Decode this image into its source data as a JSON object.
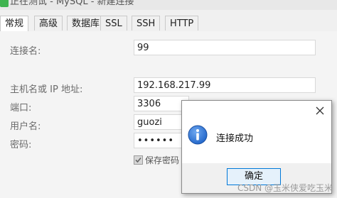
{
  "window": {
    "title": "正在测试 - MySQL - 新建连接"
  },
  "tabs": [
    {
      "label": "常规",
      "active": true
    },
    {
      "label": "高级",
      "active": false
    },
    {
      "label": "数据库",
      "active": false
    },
    {
      "label": "SSL",
      "active": false
    },
    {
      "label": "SSH",
      "active": false
    },
    {
      "label": "HTTP",
      "active": false
    }
  ],
  "form": {
    "connection_name": {
      "label": "连接名:",
      "value": "99"
    },
    "host": {
      "label": "主机名或 IP 地址:",
      "value": "192.168.217.99"
    },
    "port": {
      "label": "端口:",
      "value": "3306"
    },
    "username": {
      "label": "用户名:",
      "value": "guozi"
    },
    "password": {
      "label": "密码:",
      "value": "••••••"
    },
    "save_password": {
      "label": "保存密码",
      "checked": true
    }
  },
  "dialog": {
    "icon": "info-icon",
    "message": "连接成功",
    "ok_label": "确定",
    "close_icon": "close-icon",
    "accent_color": "#0078d7",
    "icon_color": "#1f64c8"
  },
  "watermark": "CSDN @玉米侠爱吃玉米"
}
